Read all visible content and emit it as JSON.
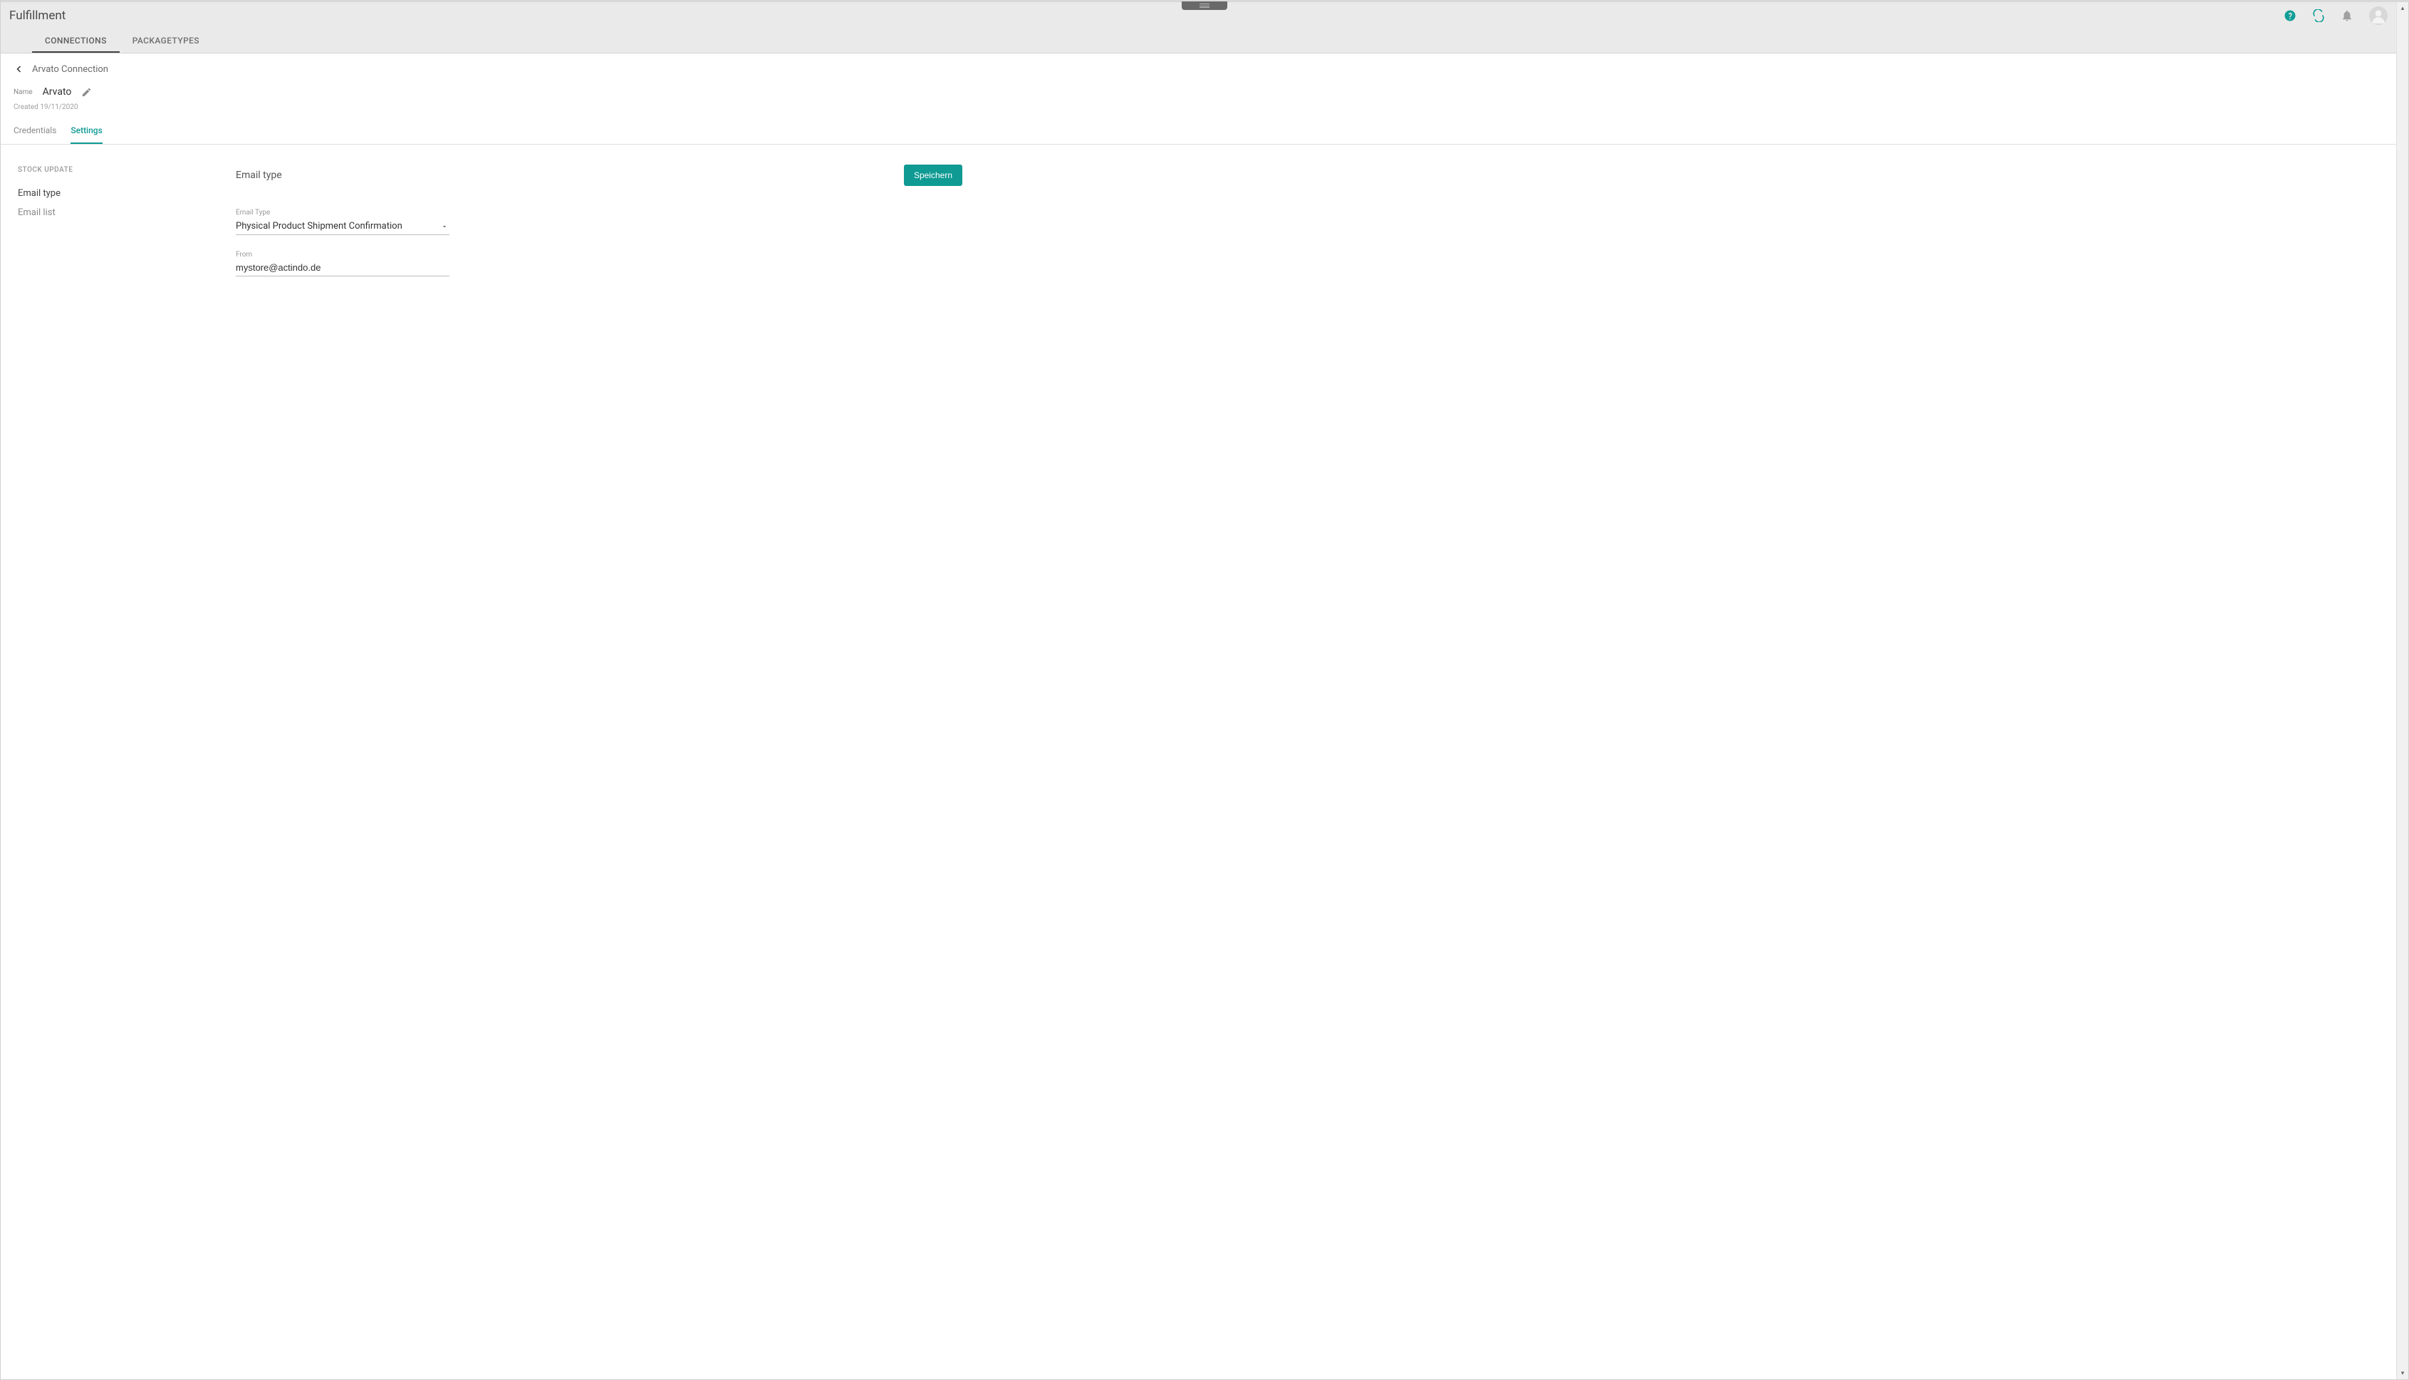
{
  "header": {
    "title": "Fulfillment"
  },
  "tabs": {
    "connections": "CONNECTIONS",
    "packagetypes": "PACKAGETYPES"
  },
  "breadcrumb": {
    "text": "Arvato Connection"
  },
  "record": {
    "name_label": "Name",
    "name_value": "Arvato",
    "created_text": "Created 19/11/2020"
  },
  "subtabs": {
    "credentials": "Credentials",
    "settings": "Settings"
  },
  "sidebar": {
    "section_title": "STOCK UPDATE",
    "items": {
      "email_type": "Email type",
      "email_list": "Email list"
    }
  },
  "panel": {
    "title": "Email type",
    "save_label": "Speichern"
  },
  "form": {
    "email_type": {
      "label": "Email Type",
      "value": "Physical Product Shipment Confirmation"
    },
    "from": {
      "label": "From",
      "value": "mystore@actindo.de"
    }
  }
}
